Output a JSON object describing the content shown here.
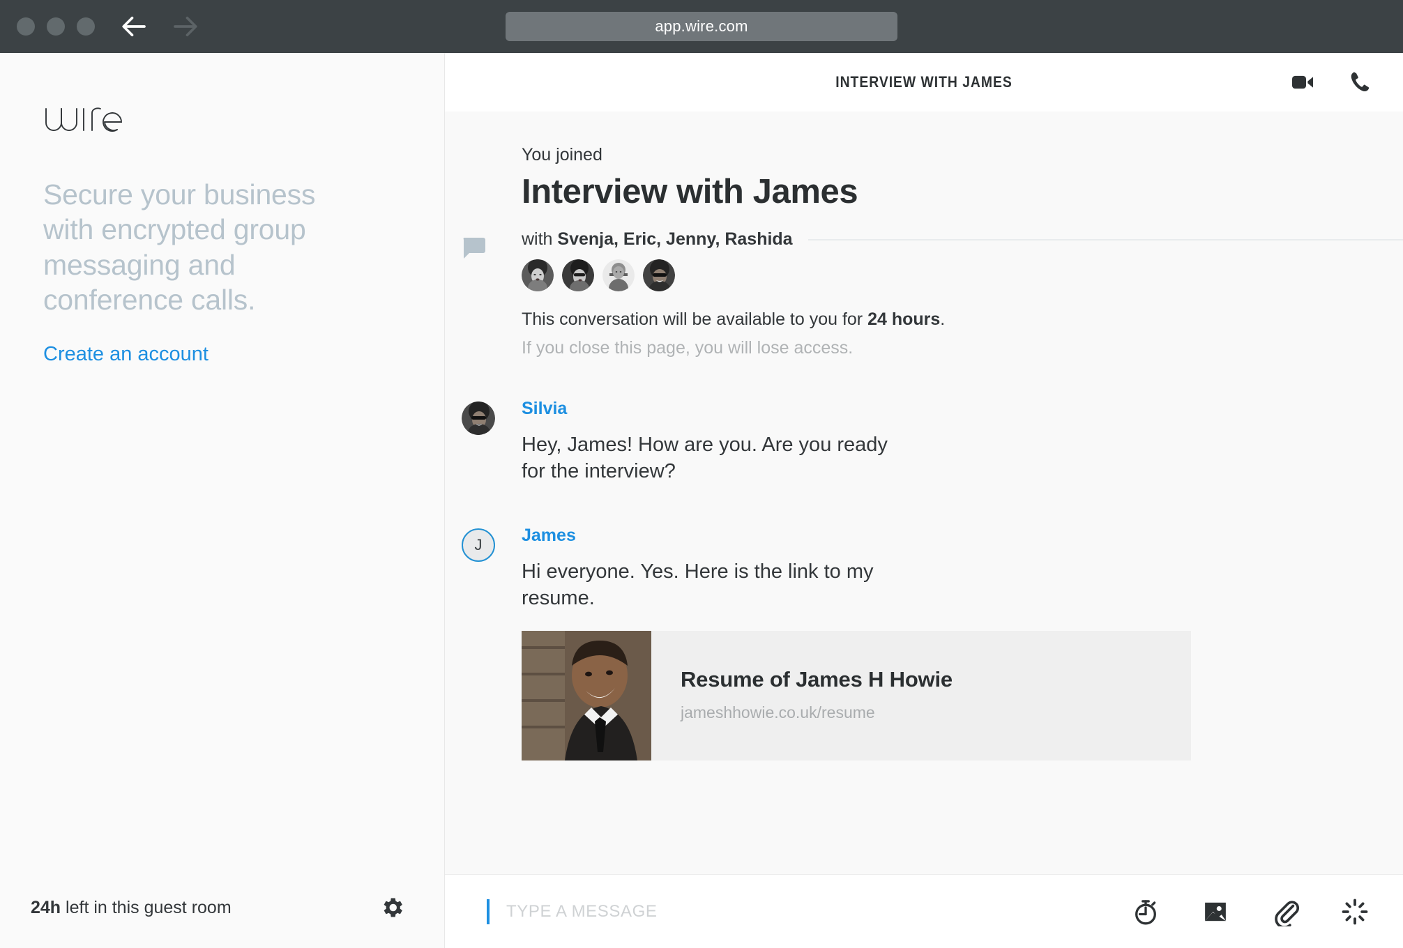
{
  "browser": {
    "url": "app.wire.com",
    "back_icon": "back-arrow-icon",
    "forward_icon": "forward-arrow-icon",
    "traffic_lights": [
      "close",
      "minimize",
      "maximize"
    ]
  },
  "sidebar": {
    "logo_text": "wire",
    "tagline": "Secure your business with encrypted group messaging and conference calls.",
    "create_account_label": "Create an account",
    "guest_time": "24h",
    "guest_note": " left in this guest room",
    "settings_icon": "gear-icon"
  },
  "conversation": {
    "header_title": "INTERVIEW WITH JAMES",
    "video_call_icon": "video-camera-icon",
    "voice_call_icon": "phone-icon",
    "joined_label": "You joined",
    "title": "Interview with James",
    "with_prefix": "with ",
    "participants_text": "Svenja, Eric, Jenny, Rashida",
    "participants": [
      "Svenja",
      "Eric",
      "Jenny",
      "Rashida"
    ],
    "availability_prefix": "This conversation will be available to you for ",
    "availability_duration": "24 hours",
    "availability_suffix": ".",
    "warning": "If you close this page, you will lose access.",
    "messages": [
      {
        "sender": "Silvia",
        "avatar_type": "photo",
        "text": "Hey, James! How are you. Are you ready for the interview?"
      },
      {
        "sender": "James",
        "avatar_type": "initials",
        "avatar_initial": "J",
        "text": "Hi everyone. Yes. Here is the link to my resume.",
        "link_preview": {
          "title": "Resume of James H Howie",
          "url": "jameshhowie.co.uk/resume"
        }
      }
    ]
  },
  "composer": {
    "placeholder": "TYPE A MESSAGE",
    "actions": [
      {
        "icon": "timer-icon"
      },
      {
        "icon": "image-icon"
      },
      {
        "icon": "paperclip-icon"
      },
      {
        "icon": "ping-icon"
      }
    ]
  },
  "colors": {
    "accent_blue": "#1d8fe1",
    "chrome_bg": "#3c4245",
    "sidebar_bg": "#fafafa",
    "conversation_bg": "#f9f9f9",
    "tagline_gray": "#b6c3cc"
  }
}
